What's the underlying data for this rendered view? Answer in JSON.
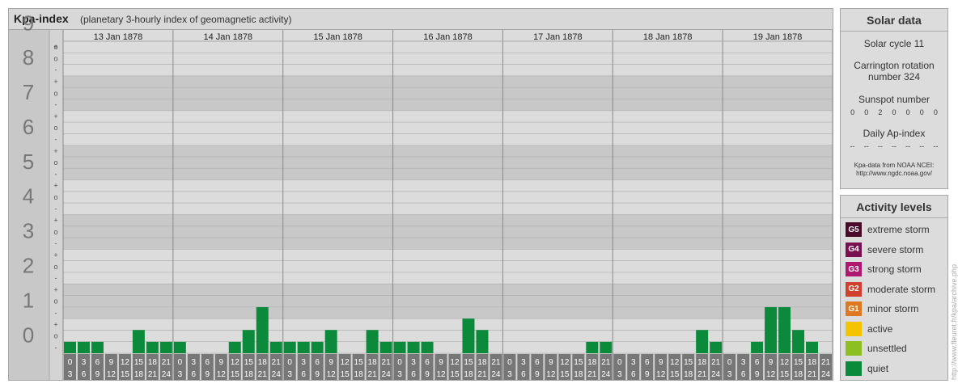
{
  "header": {
    "title": "Kpa-index",
    "subtitle": "(planetary 3-hourly index of geomagnetic activity)"
  },
  "chart_data": {
    "type": "bar",
    "ylim": [
      0,
      9
    ],
    "y_ticks": [
      "0",
      "1",
      "2",
      "3",
      "4",
      "5",
      "6",
      "7",
      "8",
      "9"
    ],
    "minor_ticks": [
      "-",
      "o",
      "+"
    ],
    "days": [
      "13 Jan 1878",
      "14 Jan 1878",
      "15 Jan 1878",
      "16 Jan 1878",
      "17 Jan 1878",
      "18 Jan 1878",
      "19 Jan 1878"
    ],
    "interval_top": [
      "0",
      "3",
      "6",
      "9",
      "12",
      "15",
      "18",
      "21"
    ],
    "interval_bottom": [
      "3",
      "6",
      "9",
      "12",
      "15",
      "18",
      "21",
      "24"
    ],
    "values": [
      [
        0.33,
        0.33,
        0.33,
        0,
        0,
        0.67,
        0.33,
        0.33
      ],
      [
        0.33,
        0,
        0,
        0,
        0.33,
        0.67,
        1.33,
        0.33
      ],
      [
        0.33,
        0.33,
        0.33,
        0.67,
        0,
        0,
        0.67,
        0.33
      ],
      [
        0.33,
        0.33,
        0.33,
        0,
        0,
        1,
        0.67,
        0
      ],
      [
        0,
        0,
        0,
        0,
        0,
        0,
        0.33,
        0.33
      ],
      [
        0,
        0,
        0,
        0,
        0,
        0,
        0.67,
        0.33
      ],
      [
        0,
        0,
        0.33,
        1.33,
        1.33,
        0.67,
        0.33,
        0
      ]
    ],
    "colors": {
      "quiet": "#0b8a3b",
      "grid": "#b0b0b0",
      "band_dark": "#c8c8c8",
      "band_light": "#dcdcdc",
      "tick_box": "#777777"
    }
  },
  "solar": {
    "title": "Solar data",
    "cycle": "Solar cycle 11",
    "carrington": "Carrington rotation number 324",
    "sunspot_label": "Sunspot number",
    "sunspots": [
      "0",
      "0",
      "2",
      "0",
      "0",
      "0",
      "0"
    ],
    "ap_label": "Daily Ap-index",
    "ap_values": [
      "--",
      "--",
      "--",
      "--",
      "--",
      "--",
      "--"
    ],
    "credit_line1": "Kpa-data from NOAA NCEI:",
    "credit_line2": "http://www.ngdc.noaa.gov/"
  },
  "activity": {
    "title": "Activity levels",
    "levels": [
      {
        "code": "G5",
        "label": "extreme storm",
        "color": "#4a0a2a"
      },
      {
        "code": "G4",
        "label": "severe storm",
        "color": "#7a1050"
      },
      {
        "code": "G3",
        "label": "strong storm",
        "color": "#b01870"
      },
      {
        "code": "G2",
        "label": "moderate storm",
        "color": "#d0402a"
      },
      {
        "code": "G1",
        "label": "minor storm",
        "color": "#e07820"
      },
      {
        "code": "",
        "label": "active",
        "color": "#f4c400"
      },
      {
        "code": "",
        "label": "unsettled",
        "color": "#8cc020"
      },
      {
        "code": "",
        "label": "quiet",
        "color": "#0b8a3b"
      }
    ]
  },
  "watermark": "http://www.fleuret.fr/kpa/archive.php"
}
